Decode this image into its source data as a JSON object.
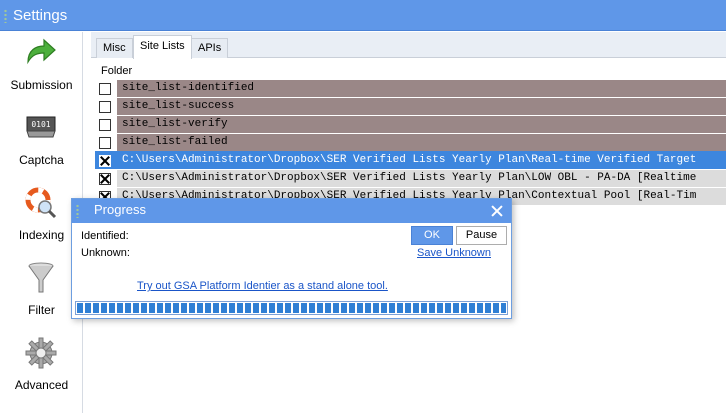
{
  "window": {
    "title": "Settings"
  },
  "sidebar": {
    "items": [
      {
        "label": "Submission",
        "icon": "green-arrow-icon"
      },
      {
        "label": "Captcha",
        "icon": "captcha-icon"
      },
      {
        "label": "Indexing",
        "icon": "lifebuoy-magnifier-icon"
      },
      {
        "label": "Filter",
        "icon": "funnel-icon"
      },
      {
        "label": "Advanced",
        "icon": "gear-icon"
      }
    ]
  },
  "tabs": [
    {
      "label": "Misc",
      "active": false
    },
    {
      "label": "Site Lists",
      "active": true
    },
    {
      "label": "APIs",
      "active": false
    }
  ],
  "folder_label": "Folder",
  "rows": [
    {
      "text": "site_list-identified",
      "checked": false
    },
    {
      "text": "site_list-success",
      "checked": false
    },
    {
      "text": "site_list-verify",
      "checked": false
    },
    {
      "text": "site_list-failed",
      "checked": false
    },
    {
      "text": "C:\\Users\\Administrator\\Dropbox\\SER Verified Lists Yearly Plan\\Real-time Verified Target",
      "checked": true
    },
    {
      "text": "C:\\Users\\Administrator\\Dropbox\\SER Verified Lists Yearly Plan\\LOW OBL - PA-DA [Realtime",
      "checked": true
    },
    {
      "text": "C:\\Users\\Administrator\\Dropbox\\SER Verified Lists Yearly Plan\\Contextual Pool [Real-Tim",
      "checked": true
    }
  ],
  "progress_dialog": {
    "title": "Progress",
    "identified_label": "Identified:",
    "unknown_label": "Unknown:",
    "ok_label": "OK",
    "pause_label": "Pause",
    "save_unknown_label": "Save Unknown",
    "promo_link": "Try out GSA Platform Identier as a stand alone tool.",
    "progress": 1.0
  },
  "colors": {
    "title_bar": "#5f97e8",
    "selected_row": "#3d86de",
    "unchecked_row": "#9a8787",
    "checked_row": "#dcdcdc",
    "link": "#1a55c8"
  }
}
